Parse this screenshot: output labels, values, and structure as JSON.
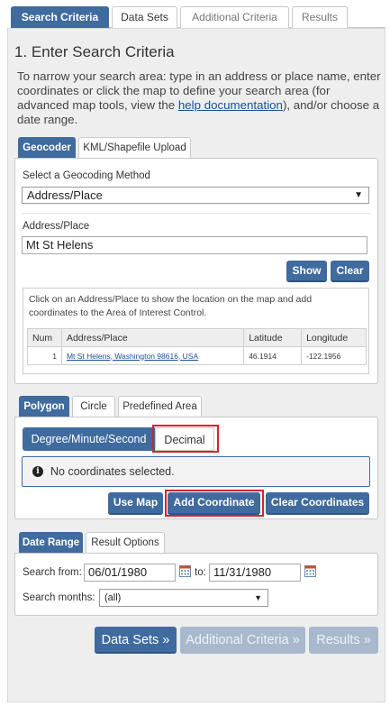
{
  "top_tabs": [
    "Search Criteria",
    "Data Sets",
    "Additional Criteria",
    "Results"
  ],
  "title": "1. Enter Search Criteria",
  "intro": {
    "text_before": "To narrow your search area: type in an address or place name, enter coordinates or click the map to define your search area (for advanced map tools, view the ",
    "link": "help documentation",
    "text_after": "), and/or choose a date range."
  },
  "geo_tabs": [
    "Geocoder",
    "KML/Shapefile Upload"
  ],
  "geocoder": {
    "method_label": "Select a Geocoding Method",
    "method_value": "Address/Place",
    "address_label": "Address/Place",
    "address_value": "Mt St Helens",
    "show_label": "Show",
    "clear_label": "Clear",
    "hint": "Click on an Address/Place to show the location on the map and add coordinates to the Area of Interest Control.",
    "columns": [
      "Num",
      "Address/Place",
      "Latitude",
      "Longitude"
    ],
    "rows": [
      {
        "num": "1",
        "address": "Mt St Helens, Washington 98616, USA",
        "lat": "46.1914",
        "lon": "-122.1956"
      }
    ]
  },
  "shape_tabs": [
    "Polygon",
    "Circle",
    "Predefined Area"
  ],
  "polygon": {
    "seg_dms": "Degree/Minute/Second",
    "seg_decimal": "Decimal",
    "info": "No coordinates selected.",
    "use_map": "Use Map",
    "add_coordinate": "Add Coordinate",
    "clear_coordinates": "Clear Coordinates"
  },
  "date_tabs": [
    "Date Range",
    "Result Options"
  ],
  "date": {
    "from_label": "Search from:",
    "from_value": "06/01/1980",
    "to_label": "to:",
    "to_value": "11/31/1980",
    "months_label": "Search months:",
    "months_value": "(all)"
  },
  "nav": {
    "data_sets": "Data Sets »",
    "additional": "Additional Criteria »",
    "results": "Results »"
  },
  "colors": {
    "accent": "#3f6b9f",
    "highlight": "#d4242d",
    "disabled": "#a8b9cd"
  }
}
